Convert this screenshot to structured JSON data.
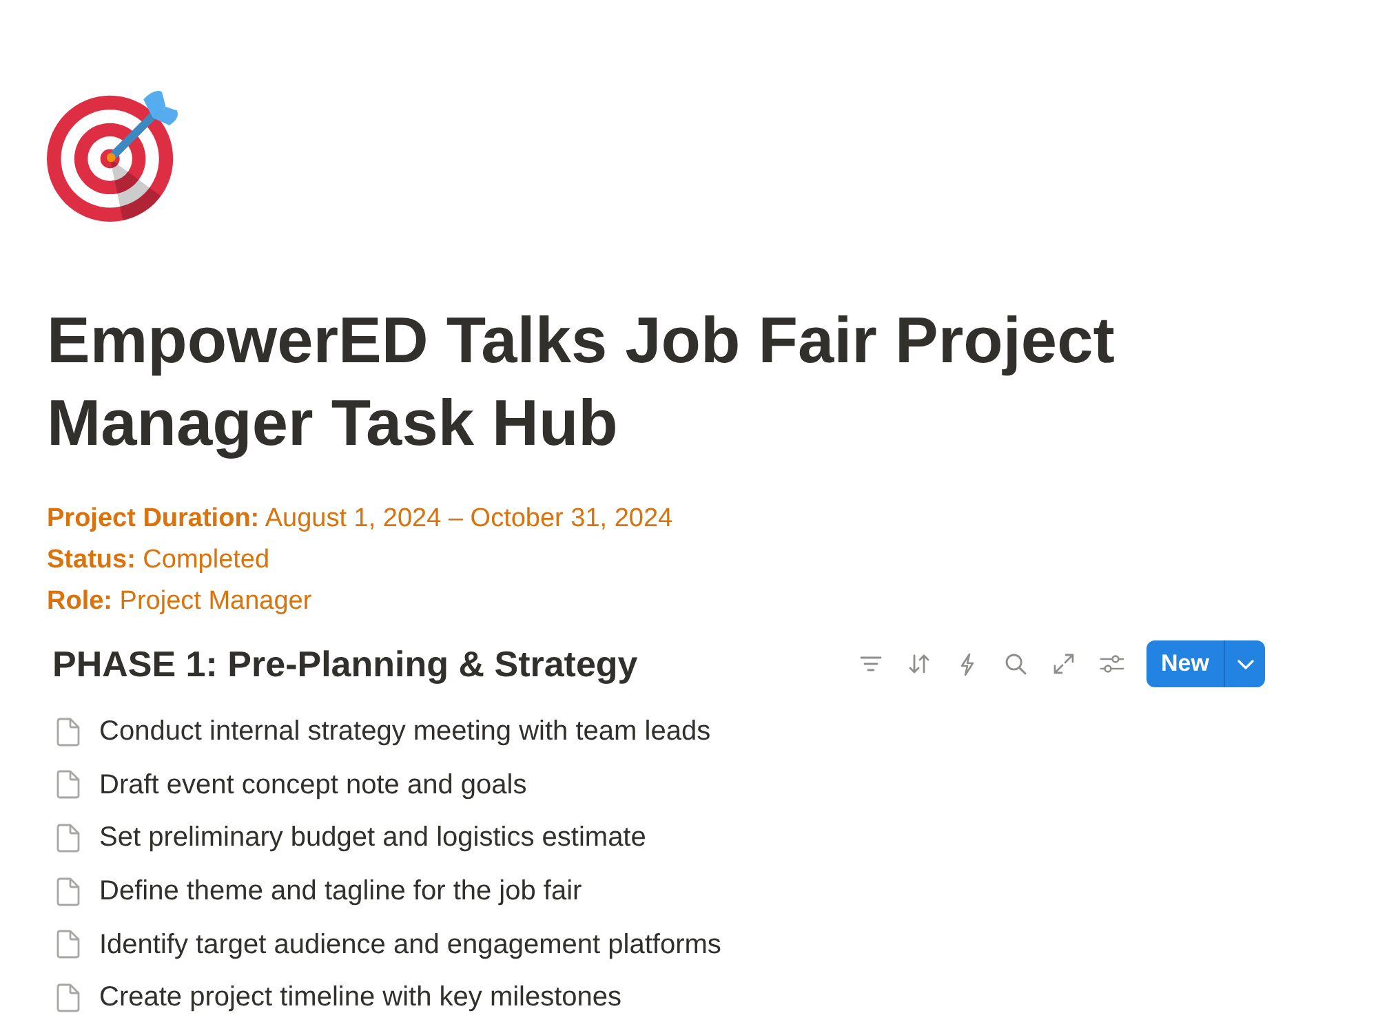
{
  "page": {
    "title": "EmpowerED Talks Job Fair Project Manager Task Hub"
  },
  "properties": [
    {
      "text": "**Project Duration:** August 1, 2024 – October 31, 2024"
    },
    {
      "text": "**Status:** Completed"
    },
    {
      "text": "**Role:** Project Manager"
    }
  ],
  "database": {
    "title": "PHASE 1: Pre-Planning & Strategy",
    "new_button": "New",
    "rows": [
      {
        "title": "Conduct internal strategy meeting with team leads"
      },
      {
        "title": "Draft event concept note and goals"
      },
      {
        "title": "Set preliminary budget and logistics estimate"
      },
      {
        "title": "Define theme and tagline for the job fair"
      },
      {
        "title": "Identify target audience and engagement platforms"
      },
      {
        "title": "Create project timeline with key milestones"
      }
    ]
  }
}
